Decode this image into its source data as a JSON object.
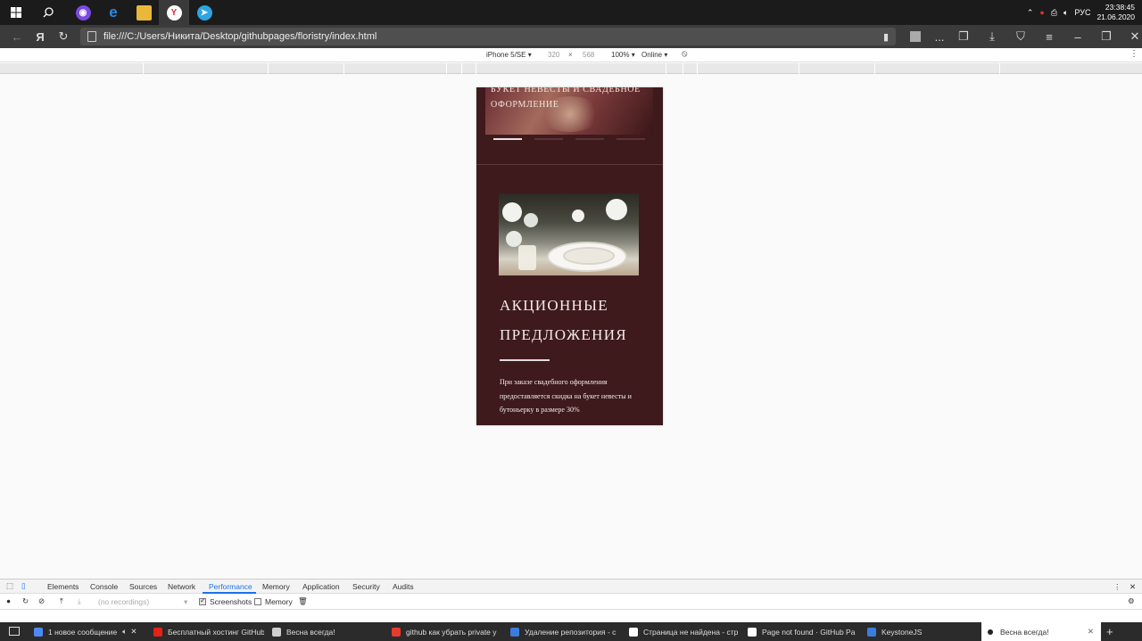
{
  "taskbar": {
    "apps": [
      "windows-start",
      "search",
      "alice",
      "edge",
      "explorer",
      "yandex-browser",
      "telegram"
    ],
    "tray": {
      "language": "РУС",
      "time": "23:38:45",
      "date": "21.06.2020"
    }
  },
  "browser": {
    "url": "file:///C:/Users/Никита/Desktop/githubpages/floristry/index.html",
    "menu_dots": "..."
  },
  "device_toolbar": {
    "device": "iPhone 5/SE",
    "width": "320",
    "height": "568",
    "zoom": "100%",
    "network": "Online"
  },
  "page": {
    "hero_title": "БУКЕТ НЕВЕСТЫ И СВАДЕБНОЕ ОФОРМЛЕНИЕ",
    "slider": {
      "count": 4,
      "active": 0
    },
    "promo_title": "АКЦИОННЫЕ ПРЕДЛОЖЕНИЯ",
    "promo_text": "При заказе свадебного оформления предоставляется скидка на букет невесты и бутоньерку в размере 30%"
  },
  "devtools": {
    "tabs": [
      "Elements",
      "Console",
      "Sources",
      "Network",
      "Performance",
      "Memory",
      "Application",
      "Security",
      "Audits"
    ],
    "active_tab": "Performance",
    "recordings_placeholder": "(no recordings)",
    "screenshots_label": "Screenshots",
    "memory_label": "Memory"
  },
  "bottom_tabs": [
    {
      "title": "1 новое сообщение",
      "color": "#4c8bf5"
    },
    {
      "title": "Бесплатный хостинг GitHub",
      "color": "#e62117"
    },
    {
      "title": "Весна всегда!",
      "color": "#cfcfcf"
    },
    {
      "title": "github как убрать private y",
      "color": "#e83a2e"
    },
    {
      "title": "Удаление репозитория - с",
      "color": "#3b7ddd"
    },
    {
      "title": "Страница не найдена - стр",
      "color": "#ffffff"
    },
    {
      "title": "Page not found · GitHub Pa",
      "color": "#ffffff"
    },
    {
      "title": "KeystoneJS",
      "color": "#3b7ddd"
    },
    {
      "title": "Весна всегда!",
      "color": "#222222"
    }
  ],
  "colors": {
    "page_bg": "#3e1a1d",
    "devtools_accent": "#1a73e8"
  }
}
